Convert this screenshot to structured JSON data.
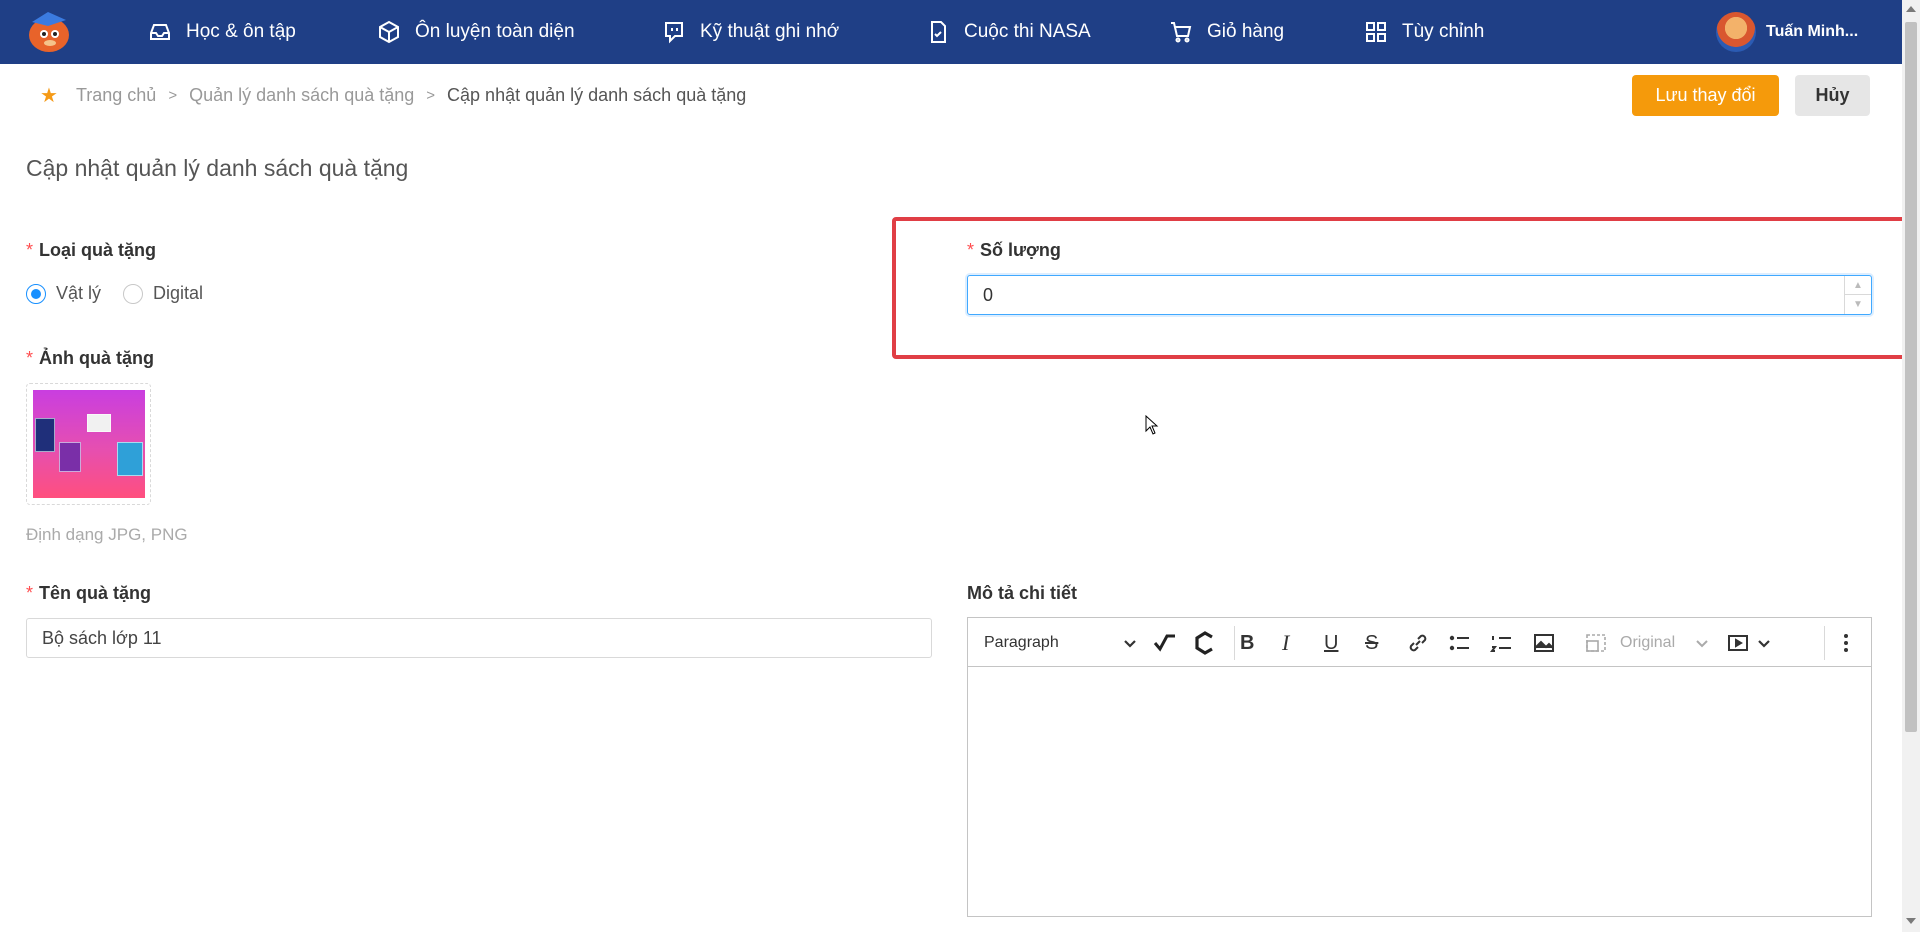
{
  "nav": {
    "items": [
      {
        "label": "Học & ôn tập",
        "icon": "inbox-icon"
      },
      {
        "label": "Ôn luyện toàn diện",
        "icon": "cube-icon"
      },
      {
        "label": "Kỹ thuật ghi nhớ",
        "icon": "chat-bubble-icon"
      },
      {
        "label": "Cuộc thi NASA",
        "icon": "document-check-icon"
      },
      {
        "label": "Giỏ hàng",
        "icon": "cart-icon"
      },
      {
        "label": "Tùy chỉnh",
        "icon": "grid-icon"
      }
    ],
    "user_name": "Tuấn Minh..."
  },
  "breadcrumb": {
    "home": "Trang chủ",
    "separator": ">",
    "parent": "Quản lý danh sách quà tặng",
    "current": "Cập nhật quản lý danh sách quà tặng"
  },
  "actions": {
    "save": "Lưu thay đổi",
    "cancel": "Hủy"
  },
  "page_title": "Cập nhật quản lý danh sách quà tặng",
  "form": {
    "required_mark": "*",
    "gift_type": {
      "label": "Loại quà tặng",
      "options": [
        "Vật lý",
        "Digital"
      ],
      "selected": "Vật lý"
    },
    "quantity": {
      "label": "Số lượng",
      "value": "0"
    },
    "gift_image": {
      "label": "Ảnh quà tặng",
      "hint": "Định dạng JPG, PNG"
    },
    "gift_name": {
      "label": "Tên quà tặng",
      "value": "Bộ sách lớp 11"
    },
    "description": {
      "label": "Mô tả chi tiết",
      "heading_select": "Paragraph",
      "image_size_select": "Original"
    }
  },
  "colors": {
    "nav_bg": "#1f3f86",
    "accent": "#f59a0b",
    "highlight": "#e03e45",
    "focus": "#1890ff"
  }
}
